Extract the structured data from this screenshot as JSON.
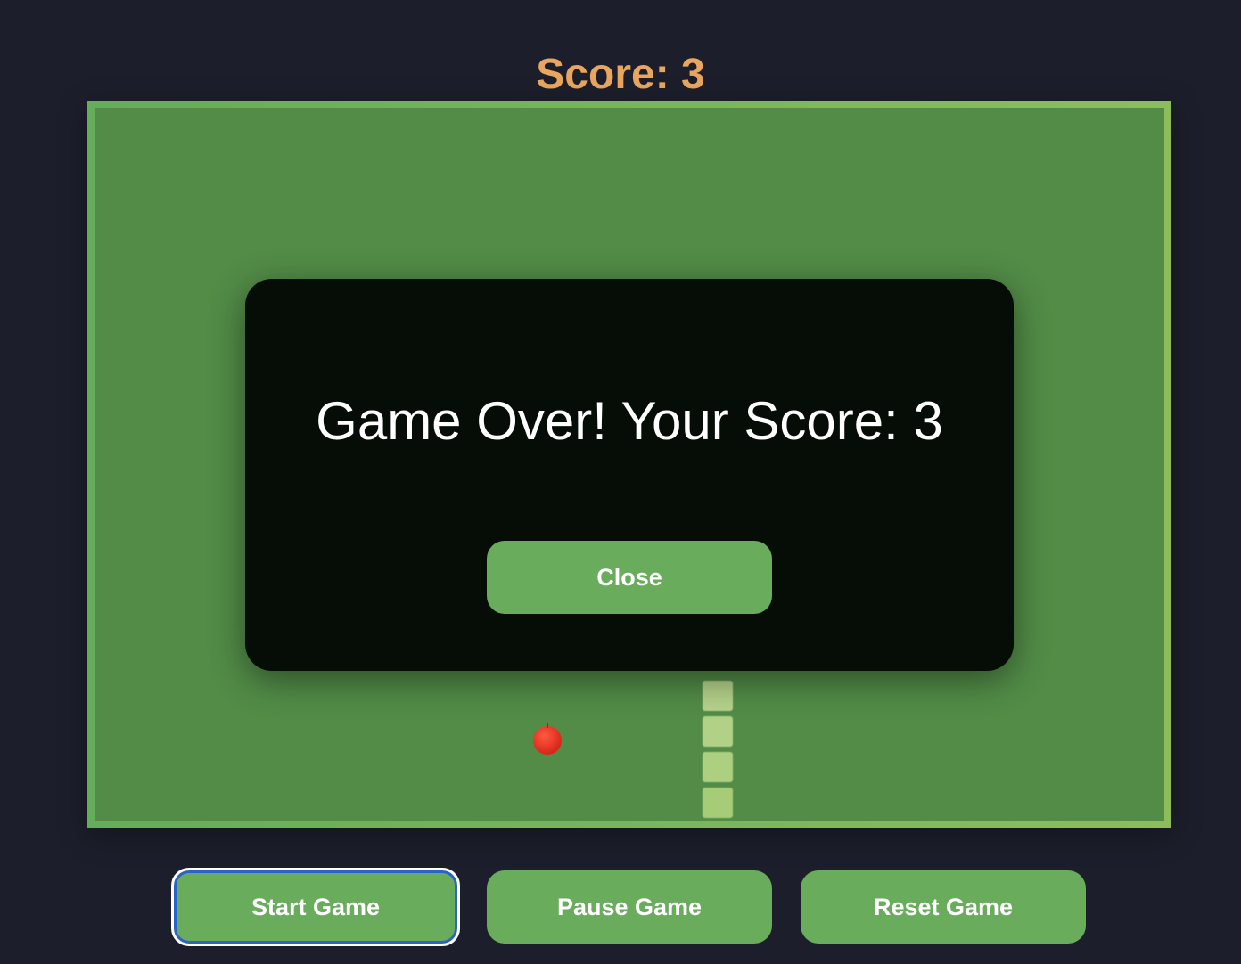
{
  "header": {
    "score_text": "Score: 3"
  },
  "board": {
    "background_color": "#528c47",
    "border_color": "#6fb25c",
    "food": {
      "icon": "apple-icon",
      "color": "#e0301f"
    },
    "snake": {
      "segment_count": 4,
      "color": "#a6cc78"
    }
  },
  "modal": {
    "message": "Game Over! Your Score: 3",
    "close_label": "Close"
  },
  "controls": {
    "start_label": "Start Game",
    "pause_label": "Pause Game",
    "reset_label": "Reset Game"
  },
  "colors": {
    "accent": "#e9a65e",
    "button": "#68ac5c",
    "page_background": "#1c1f2b"
  }
}
